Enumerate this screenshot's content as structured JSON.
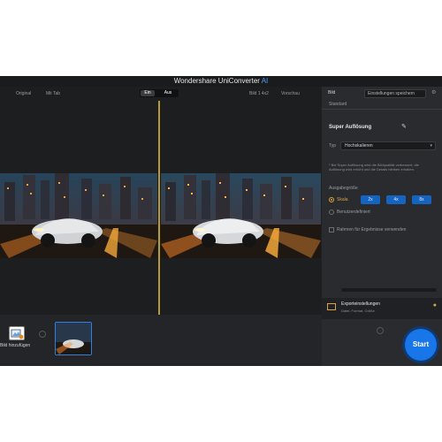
{
  "app": {
    "title": "Wondershare UniConverter",
    "title_ai": "AI"
  },
  "preview": {
    "left_label": "Original",
    "left_label_2": "Mit Tab",
    "toggle": {
      "left": "Ein",
      "right": "Aus"
    },
    "right_label": "Bild 1 4x2",
    "right_label_2": "Vorschau"
  },
  "panel": {
    "top_left": "Bild",
    "top_dropdown": "Einstellungen speichern",
    "sub_label": "Standard",
    "section_title": "Super Auflösung",
    "row_label": "Typ",
    "dropdown_value": "Hochskalieren",
    "description": "* Bei Super Auflösung wird die Bildqualität verbessert, die Auflösung wird erhöht und die Details bleiben erhalten.",
    "resolution_label": "Ausgabegröße",
    "option1": "Skala",
    "scale_options": [
      "2x",
      "4x",
      "8x"
    ],
    "option2": "Benutzerdefiniert",
    "checkbox_label": "Rahmen für Ergebnisse verwenden",
    "notify_title": "Exporteinstellungen",
    "notify_sub": "Datei, Format, Größe"
  },
  "bottom": {
    "add_label": "Bild hinzufügen",
    "start": "Start"
  },
  "colors": {
    "accent": "#1976e8",
    "divider": "#b89a3d",
    "highlight": "#d9a441"
  }
}
